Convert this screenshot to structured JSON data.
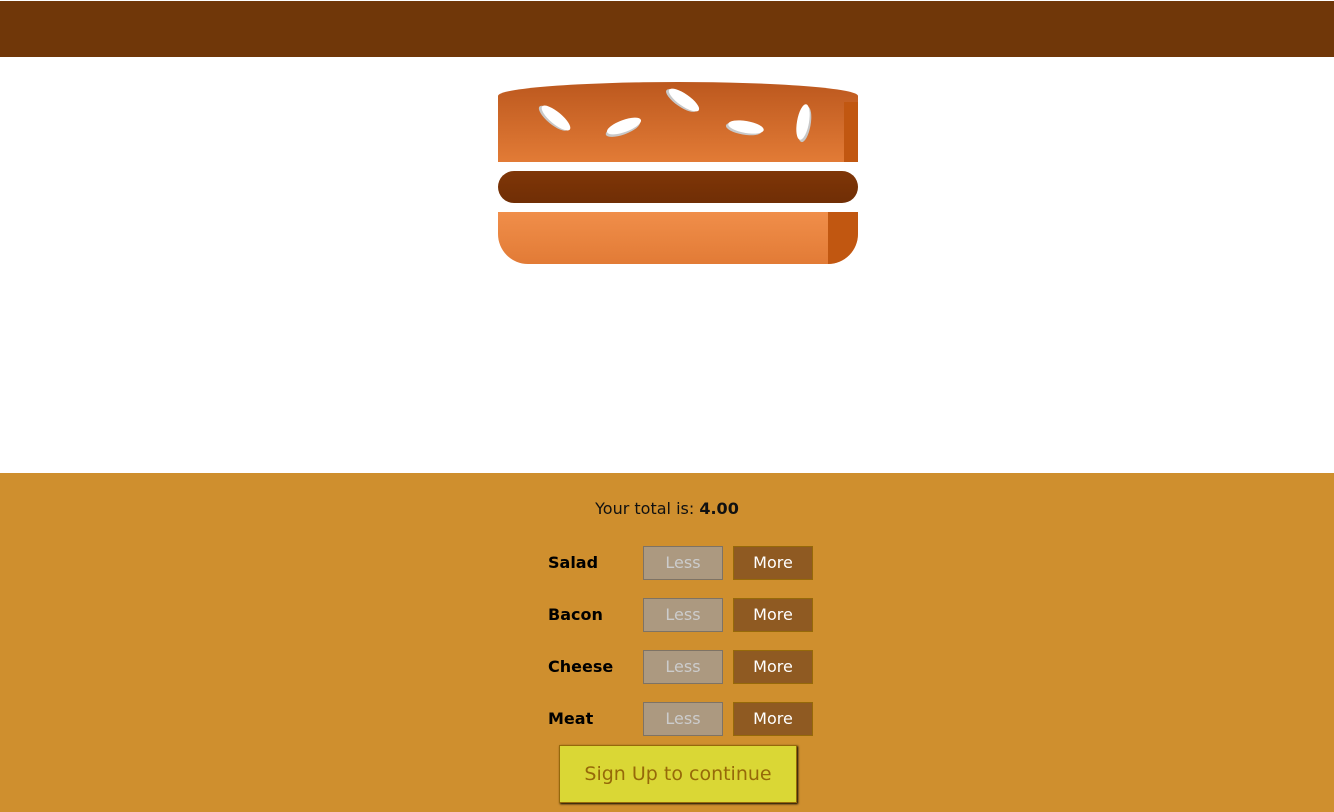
{
  "colors": {
    "toolbar": "#703709",
    "controls_bg": "#cf8f2e",
    "bread_top": "#bc581e",
    "meat": "#7f3608",
    "bread_bottom": "#f08e4a",
    "less_button": "#ac9980",
    "more_button": "#8f5a22",
    "order_button": "#dad735"
  },
  "burger": {
    "ingredients": [
      "bread-top",
      "meat",
      "bread-bottom"
    ]
  },
  "total": {
    "label": "Your total is:",
    "value": "4.00"
  },
  "controls": [
    {
      "label": "Salad",
      "less": "Less",
      "more": "More"
    },
    {
      "label": "Bacon",
      "less": "Less",
      "more": "More"
    },
    {
      "label": "Cheese",
      "less": "Less",
      "more": "More"
    },
    {
      "label": "Meat",
      "less": "Less",
      "more": "More"
    }
  ],
  "order_button": "Sign Up to continue"
}
